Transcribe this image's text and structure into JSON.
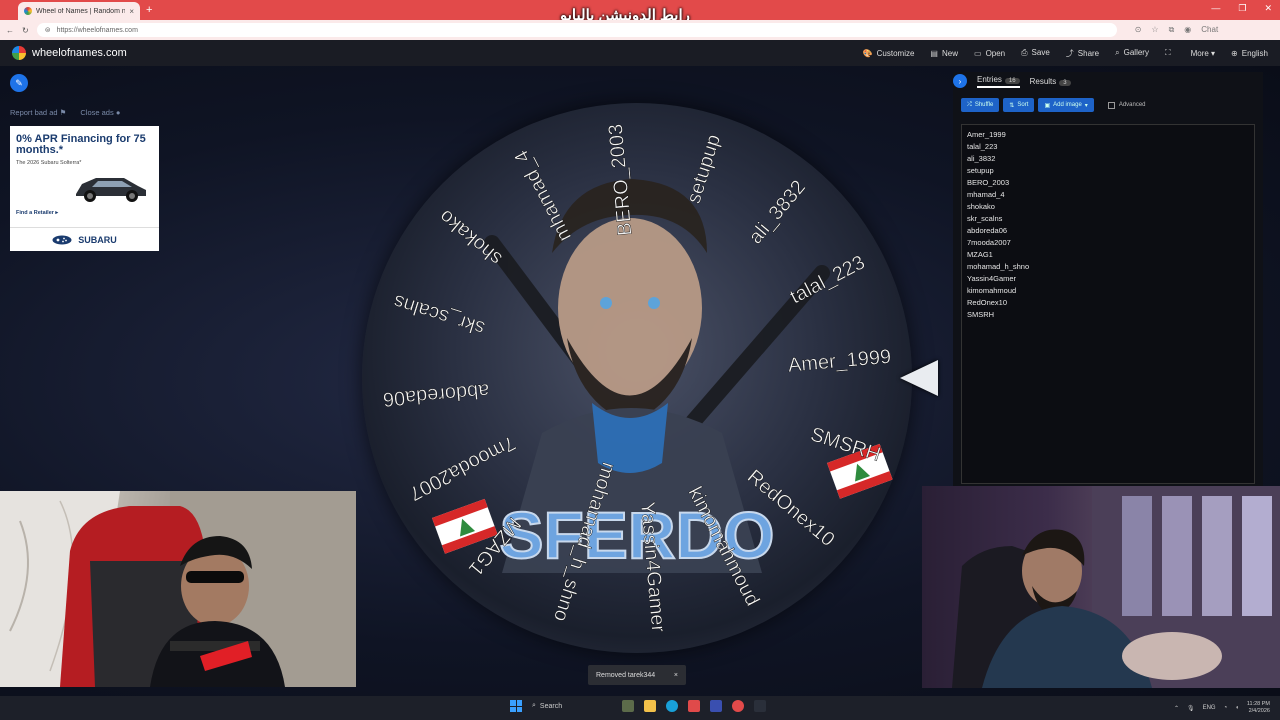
{
  "browser": {
    "tab_title": "Wheel of Names | Random n",
    "tab_close": "×",
    "new_tab": "+",
    "overlay_title": "رابط الدونيشن بالبايو",
    "url": "https://wheelofnames.com",
    "chat_label": "Chat",
    "window_min": "—",
    "window_max": "❐",
    "window_close": "✕"
  },
  "app": {
    "logo_text": "wheelofnames.com",
    "menu": [
      {
        "label": "Customize",
        "icon": "palette-icon",
        "glyph": "🎨"
      },
      {
        "label": "New",
        "icon": "file-icon",
        "glyph": "▤"
      },
      {
        "label": "Open",
        "icon": "folder-icon",
        "glyph": "▭"
      },
      {
        "label": "Save",
        "icon": "save-icon",
        "glyph": "⎙"
      },
      {
        "label": "Share",
        "icon": "share-icon",
        "glyph": "⤴"
      },
      {
        "label": "Gallery",
        "icon": "search-icon",
        "glyph": "⌕"
      },
      {
        "label": "",
        "icon": "fullscreen-icon",
        "glyph": "⛶"
      },
      {
        "label": "More ▾",
        "icon": "",
        "glyph": ""
      },
      {
        "label": "English",
        "icon": "globe-icon",
        "glyph": "⊕"
      }
    ]
  },
  "ads": {
    "report_bad_ad": "Report bad ad",
    "close_ads": "Close ads",
    "headline": "0% APR Financing for 75 months.*",
    "subline": "The 2026 Subaru Solterra*",
    "find_retailer": "Find a Retailer ▸",
    "brand": "SUBARU"
  },
  "panel": {
    "tab_entries": "Entries",
    "entries_count": "16",
    "tab_results": "Results",
    "results_count": "3",
    "btn_shuffle": "Shuffle",
    "btn_sort": "Sort",
    "btn_add_image": "Add image",
    "advanced_label": "Advanced",
    "entries": [
      "Amer_1999",
      "talal_223",
      "ali_3832",
      "setupup",
      "BERO_2003",
      "mhamad_4",
      "shokako",
      "skr_scalns",
      "abdoreda06",
      "7mooda2007",
      "MZAG1",
      "mohamad_h_shno",
      "Yassin4Gamer",
      "kimomahmoud",
      "RedOnex10",
      "SMSRH"
    ]
  },
  "wheel": {
    "logo_text": "SFERDO",
    "labels": [
      "Amer_1999",
      "talal_223",
      "ali_3832",
      "setupup",
      "BERO_2003",
      "mhamad_4",
      "shokako",
      "skr_scalns",
      "abdoreda06",
      "7mooda2007",
      "MZAG1",
      "mohamad_h_shno",
      "Yassin4Gamer",
      "kimomahmoud",
      "RedOnex10",
      "SMSRH"
    ],
    "text_color": "#f2f2f2"
  },
  "toast": {
    "message": "Removed tarek344",
    "close": "×"
  },
  "taskbar": {
    "search_label": "Search",
    "lang": "ENG",
    "time": "11:28 PM",
    "date": "2/4/2026"
  },
  "colors": {
    "accent": "#1e73e8",
    "tabbar": "#e24a4a"
  }
}
